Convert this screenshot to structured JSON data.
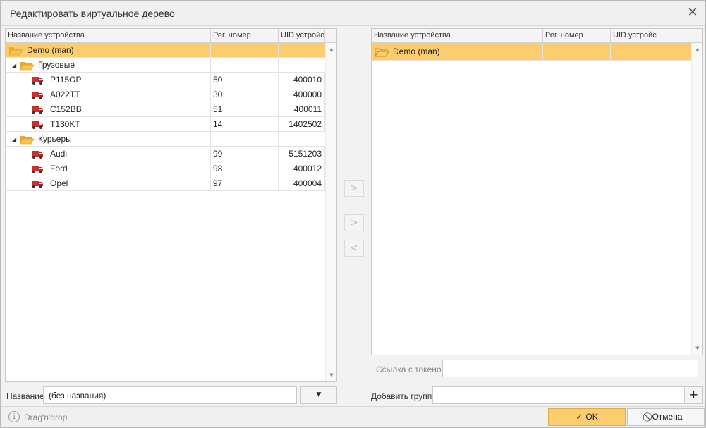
{
  "dialog": {
    "title": "Редактировать виртуальное дерево"
  },
  "columns": {
    "name": "Название устройства",
    "reg": "Рег. номер",
    "uid": "UID устройства"
  },
  "left_tree": {
    "root": "Demo (man)",
    "groups": [
      {
        "name": "Грузовые",
        "items": [
          {
            "name": "P115OP",
            "reg": "50",
            "uid": "400010"
          },
          {
            "name": "A022TT",
            "reg": "30",
            "uid": "400000"
          },
          {
            "name": "C152BB",
            "reg": "51",
            "uid": "400011"
          },
          {
            "name": "T130KT",
            "reg": "14",
            "uid": "1402502"
          }
        ]
      },
      {
        "name": "Курьеры",
        "items": [
          {
            "name": "Audi",
            "reg": "99",
            "uid": "5151203"
          },
          {
            "name": "Ford",
            "reg": "98",
            "uid": "400012"
          },
          {
            "name": "Opel",
            "reg": "97",
            "uid": "400004"
          }
        ]
      }
    ]
  },
  "right_tree": {
    "root": "Demo (man)"
  },
  "transfer_buttons": {
    "add_all": ">",
    "add": ">",
    "remove": "<"
  },
  "name_field": {
    "label": "Название",
    "value": "(без названия)"
  },
  "token_field": {
    "label": "Ссылка с токеном",
    "value": ""
  },
  "add_group": {
    "label": "Добавить группу",
    "value": "",
    "button": "+"
  },
  "footer": {
    "hint": "Drag'n'drop",
    "ok": "OK",
    "cancel": "Отмена"
  },
  "colors": {
    "selected_row": "#fbcd6e",
    "folder": "#f1b43c",
    "truck": "#c9302c"
  }
}
